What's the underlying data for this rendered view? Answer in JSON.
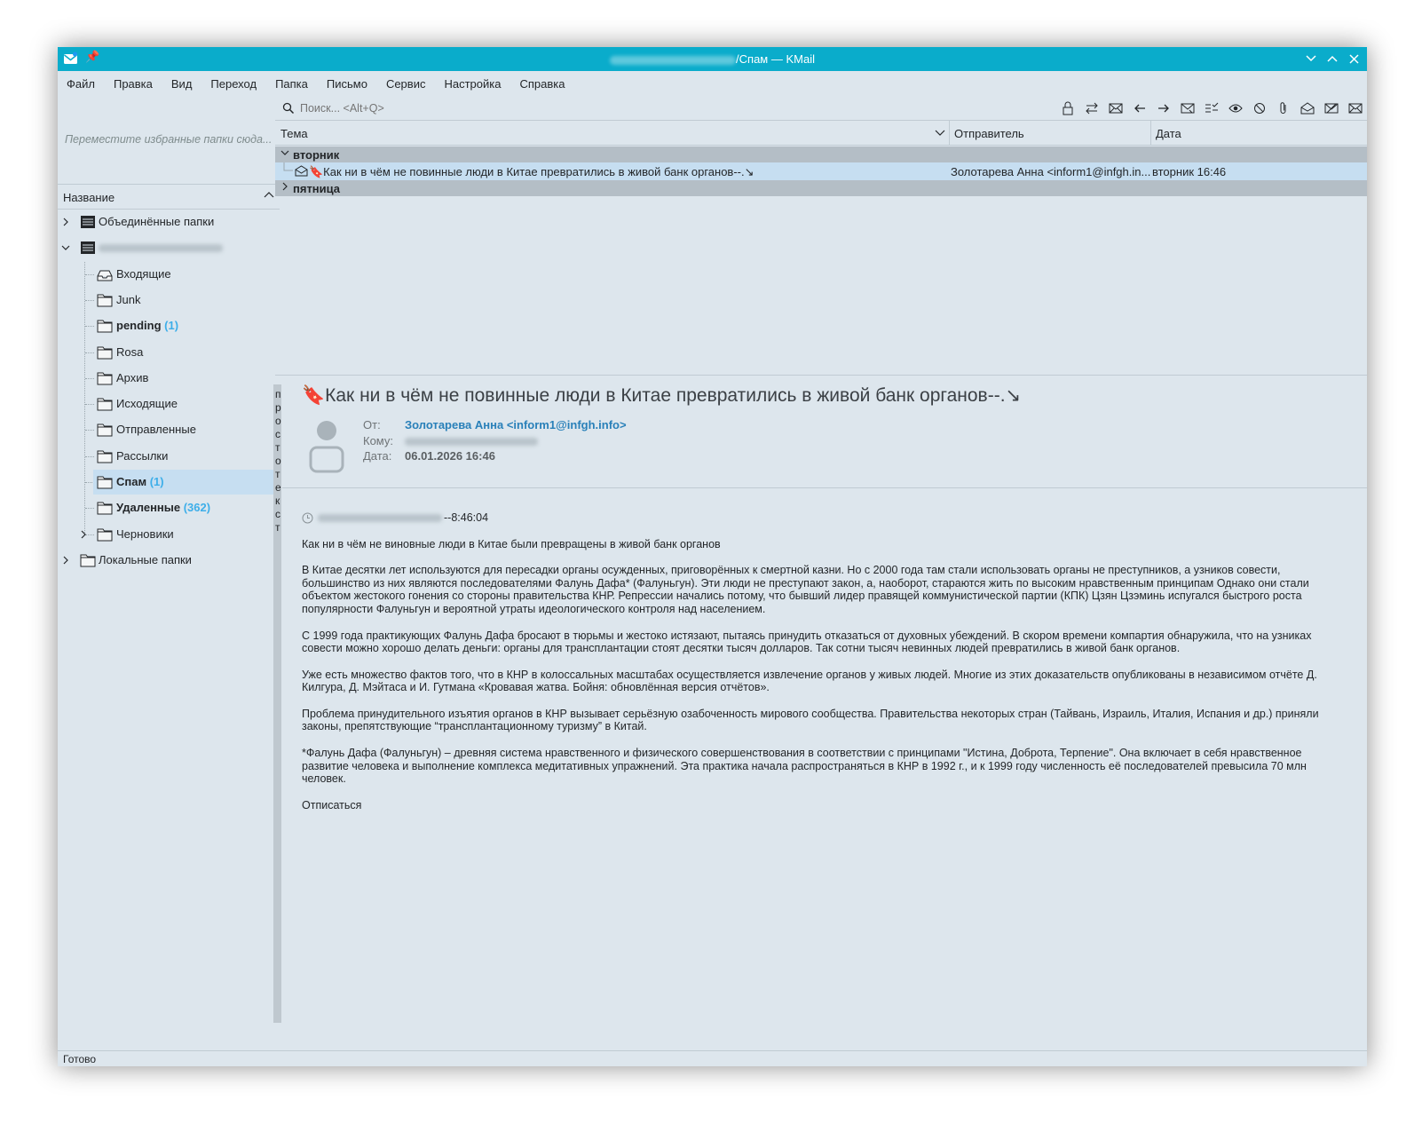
{
  "window": {
    "title_suffix": "/Спам — KMail"
  },
  "menubar": [
    "Файл",
    "Правка",
    "Вид",
    "Переход",
    "Папка",
    "Письмо",
    "Сервис",
    "Настройка",
    "Справка"
  ],
  "favorites": {
    "placeholder": "Переместите избранные папки сюда..."
  },
  "folder_tree": {
    "header": "Название",
    "top_items": [
      {
        "label": "Объединённые папки"
      }
    ],
    "account_folders": [
      {
        "label": "Входящие",
        "icon": "inbox-icon"
      },
      {
        "label": "Junk",
        "icon": "folder-icon"
      },
      {
        "label": "pending",
        "count": "(1)",
        "bold": true,
        "icon": "folder-icon"
      },
      {
        "label": "Rosa",
        "icon": "folder-icon"
      },
      {
        "label": "Архив",
        "icon": "folder-icon"
      },
      {
        "label": "Исходящие",
        "icon": "folder-icon"
      },
      {
        "label": "Отправленные",
        "icon": "folder-icon"
      },
      {
        "label": "Рассылки",
        "icon": "folder-icon"
      },
      {
        "label": "Спам",
        "count": "(1)",
        "bold": true,
        "selected": true,
        "icon": "folder-icon"
      },
      {
        "label": "Удаленные",
        "count": "(362)",
        "bold": true,
        "icon": "folder-icon"
      },
      {
        "label": "Черновики",
        "icon": "folder-icon",
        "expandable": true
      }
    ],
    "local": {
      "label": "Локальные папки"
    }
  },
  "search": {
    "placeholder": "Поиск... <Alt+Q>"
  },
  "message_list": {
    "columns": {
      "subject": "Тема",
      "sender": "Отправитель",
      "date": "Дата"
    },
    "groups": [
      {
        "label": "вторник",
        "expanded": true
      },
      {
        "label": "пятница",
        "expanded": false
      }
    ],
    "messages": [
      {
        "subject": "🔖Как ни в чём не повинные люди в Китае превратились в живой банк органов--.↘",
        "sender": "Золотарева Анна <inform1@infgh.in...",
        "date": "вторник 16:46"
      }
    ]
  },
  "separator_text": "просто текст",
  "reader": {
    "subject": "🔖Как ни в чём не повинные люди в Китае превратились в живой банк органов--.↘",
    "from_label": "От:",
    "from_value": "Золотарева Анна <inform1@infgh.info>",
    "to_label": "Кому:",
    "date_label": "Дата:",
    "date_value": "06.01.2026 16:46",
    "time_suffix": "--8:46:04",
    "paragraphs": [
      "Как ни в чём не виновные люди в Китае были превращены в живой банк органов",
      "В Китае десятки лет используются для пересадки органы осужденных, приговорённых к смертной казни. Но с 2000 года там стали использовать органы не преступников, а узников совести, большинство из них являются последователями Фалунь Дафа* (Фалуньгун). Эти люди не преступают закон, а, наоборот, стараются жить по высоким нравственным принципам Однако они стали объектом жестокого гонения со стороны правительства КНР. Репрессии начались потому, что бывший лидер правящей коммунистической партии (КПК) Цзян Цзэминь испугался быстрого роста популярности Фалуньгун и вероятной утраты идеологического контроля над населением.",
      "С 1999 года практикующих Фалунь Дафа бросают в тюрьмы и жестоко истязают, пытаясь принудить отказаться от духовных убеждений. В скором времени компартия обнаружила, что на узниках совести можно хорошо делать деньги: органы для трансплантации стоят десятки тысяч долларов. Так сотни тысяч невинных людей превратились в живой банк органов.",
      "Уже есть множество фактов того, что в КНР в колоссальных масштабах осуществляется извлечение органов у живых людей. Многие из этих доказательств опубликованы в независимом отчёте Д. Килгура, Д. Мэйтаса и И. Гутмана «Кровавая жатва. Бойня: обновлённая версия отчётов».",
      "Проблема принудительного изъятия органов в КНР вызывает серьёзную озабоченность мирового сообщества. Правительства  некоторых стран (Тайвань, Израиль, Италия, Испания и др.) приняли законы, препятствующие “трансплантационному туризму” в Китай.",
      "*Фалунь Дафа (Фалуньгун) – древняя система нравственного и физического совершенствования в соответствии с принципами \"Истина, Доброта, Терпение\".  Она включает в себя нравственное развитие человека и выполнение комплекса медитативных упражнений. Эта практика начала распространяться в КНР в 1992 г., и к 1999 году численность её последователей превысила 70 млн человек.",
      "Отписаться"
    ]
  },
  "status": "Готово",
  "colors": {
    "titlebar": "#0aaccb",
    "background": "#dde6ed",
    "selection": "#c6def1",
    "group_row": "#b4bec6",
    "accent": "#3daee9",
    "link": "#2980b9"
  }
}
